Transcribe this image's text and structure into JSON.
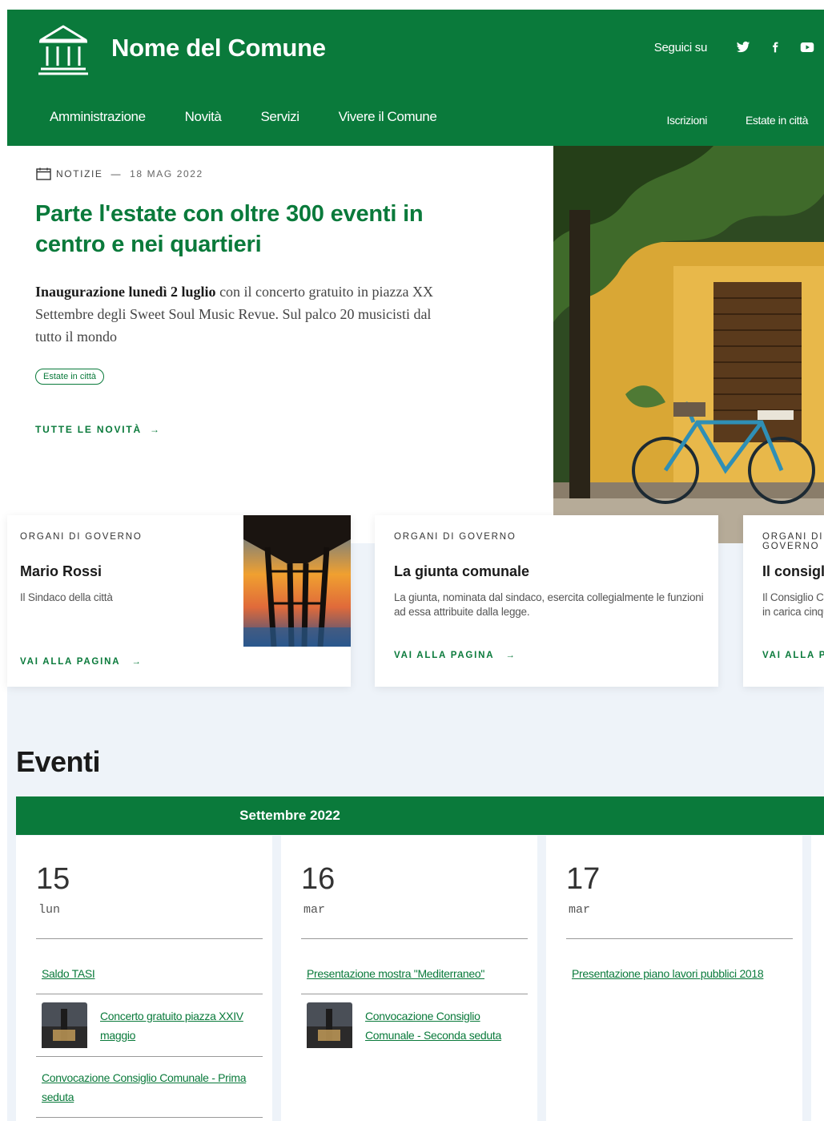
{
  "header": {
    "site_name": "Nome del Comune",
    "social_label": "Seguici su",
    "social_icons": [
      "twitter-icon",
      "facebook-icon",
      "youtube-icon"
    ],
    "nav": [
      "Amministrazione",
      "Novità",
      "Servizi",
      "Vivere il Comune"
    ],
    "nav_secondary": [
      "Iscrizioni",
      "Estate in città"
    ]
  },
  "hero": {
    "category": "NOTIZIE",
    "separator": "—",
    "date": "18 MAG 2022",
    "title": "Parte l'estate con oltre 300 eventi in centro e nei quartieri",
    "text_bold": "Inaugurazione lunedì 2 luglio",
    "text_rest": " con il concerto gratuito in piazza XX Settembre degli Sweet Soul Music Revue. Sul palco 20 musicisti dal tutto il mondo",
    "tag": "Estate in città",
    "more": "TUTTE LE NOVITÀ",
    "arrow": "→"
  },
  "cards": [
    {
      "category": "ORGANI DI GOVERNO",
      "title": "Mario Rossi",
      "description": "Il Sindaco della città",
      "link": "VAI ALLA PAGINA"
    },
    {
      "category": "ORGANI DI GOVERNO",
      "title": "La giunta comunale",
      "description": "La giunta, nominata dal sindaco, esercita collegialmente le funzioni ad essa attribuite dalla legge.",
      "link": "VAI ALLA PAGINA"
    },
    {
      "category": "ORGANI DI GOVERNO",
      "title": "Il consiglio comunale",
      "description": "Il Consiglio Comunale è eletto dai cittadini e rimane in carica cinque anni.",
      "link": "VAI ALLA PAGINA"
    }
  ],
  "events": {
    "title": "Eventi",
    "month": "Settembre 2022",
    "days": [
      {
        "number": "15",
        "name": "lun",
        "items": [
          {
            "text": "Saldo TASI",
            "image": false
          },
          {
            "text": "Concerto gratuito piazza XXIV maggio",
            "image": true
          },
          {
            "text": "Convocazione Consiglio Comunale - Prima seduta",
            "image": false
          }
        ]
      },
      {
        "number": "16",
        "name": "mar",
        "items": [
          {
            "text": "Presentazione mostra \"Mediterraneo\"",
            "image": false
          },
          {
            "text": "Convocazione Consiglio Comunale - Seconda seduta",
            "image": true
          }
        ]
      },
      {
        "number": "17",
        "name": "mar",
        "items": [
          {
            "text": "Presentazione piano lavori pubblici 2018",
            "image": false
          }
        ]
      }
    ]
  },
  "colors": {
    "primary": "#0a7a3b",
    "band": "#eef3f9"
  }
}
